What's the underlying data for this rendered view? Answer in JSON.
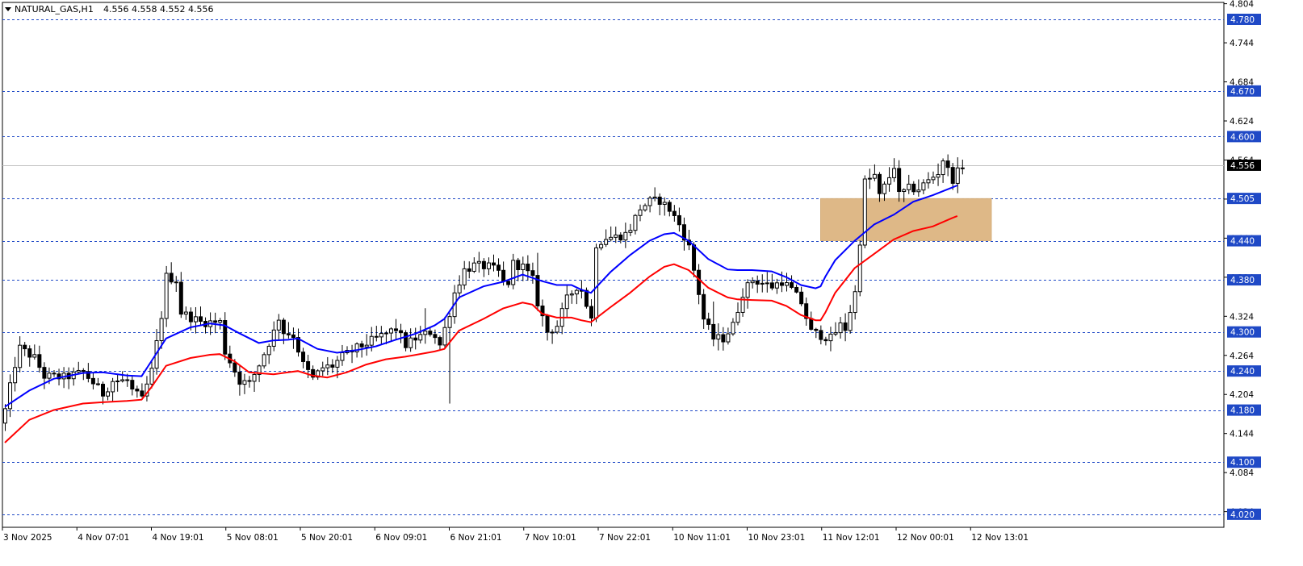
{
  "header": {
    "symbol": "NATURAL_GAS,H1",
    "ohlc": "4.556 4.558 4.552 4.556"
  },
  "colors": {
    "background": "#ffffff",
    "frame": "#000000",
    "level_line": "#1f49c6",
    "level_tag_bg": "#1f49c6",
    "level_tag_text": "#ffffff",
    "price_tag_bg": "#000000",
    "price_tag_text": "#ffffff",
    "bid_line": "#c0c0c0",
    "zone_fill": "#deb887",
    "candle_up_fill": "#ffffff",
    "candle_down_fill": "#000000",
    "ema_fast": "#0000ff",
    "ema_slow": "#ff0000"
  },
  "chart_data": {
    "type": "candlestick",
    "title": "NATURAL_GAS,H1",
    "ylim": [
      4.0,
      4.806
    ],
    "y_ticks": [
      "4.804",
      "4.744",
      "4.684",
      "4.624",
      "4.564",
      "4.504",
      "4.444",
      "4.384",
      "4.324",
      "4.264",
      "4.204",
      "4.144",
      "4.084",
      "4.024"
    ],
    "x_ticks": [
      "3 Nov 2025",
      "4 Nov 07:01",
      "4 Nov 19:01",
      "5 Nov 08:01",
      "5 Nov 20:01",
      "6 Nov 09:01",
      "6 Nov 21:01",
      "7 Nov 10:01",
      "7 Nov 22:01",
      "10 Nov 11:01",
      "10 Nov 23:01",
      "11 Nov 12:01",
      "12 Nov 00:01",
      "12 Nov 13:01"
    ],
    "level_lines": [
      "4.780",
      "4.670",
      "4.600",
      "4.505",
      "4.440",
      "4.380",
      "4.300",
      "4.240",
      "4.180",
      "4.100",
      "4.020"
    ],
    "current_price": "4.556",
    "zone": {
      "price_low": 4.44,
      "price_high": 4.505,
      "from_bar": 167,
      "to_bar": 202
    },
    "ema_fast": [
      [
        0,
        4.185
      ],
      [
        5,
        4.21
      ],
      [
        10,
        4.228
      ],
      [
        16,
        4.237
      ],
      [
        20,
        4.238
      ],
      [
        25,
        4.233
      ],
      [
        28,
        4.232
      ],
      [
        30,
        4.255
      ],
      [
        33,
        4.29
      ],
      [
        38,
        4.307
      ],
      [
        42,
        4.313
      ],
      [
        45,
        4.31
      ],
      [
        48,
        4.298
      ],
      [
        52,
        4.283
      ],
      [
        55,
        4.287
      ],
      [
        58,
        4.288
      ],
      [
        60,
        4.29
      ],
      [
        64,
        4.274
      ],
      [
        68,
        4.268
      ],
      [
        72,
        4.272
      ],
      [
        76,
        4.278
      ],
      [
        80,
        4.288
      ],
      [
        84,
        4.297
      ],
      [
        88,
        4.31
      ],
      [
        90,
        4.32
      ],
      [
        93,
        4.353
      ],
      [
        98,
        4.37
      ],
      [
        102,
        4.377
      ],
      [
        106,
        4.388
      ],
      [
        110,
        4.378
      ],
      [
        113,
        4.372
      ],
      [
        116,
        4.372
      ],
      [
        118,
        4.365
      ],
      [
        120,
        4.36
      ],
      [
        124,
        4.392
      ],
      [
        128,
        4.418
      ],
      [
        132,
        4.44
      ],
      [
        135,
        4.45
      ],
      [
        137,
        4.452
      ],
      [
        140,
        4.44
      ],
      [
        144,
        4.412
      ],
      [
        148,
        4.396
      ],
      [
        150,
        4.395
      ],
      [
        153,
        4.395
      ],
      [
        157,
        4.393
      ],
      [
        160,
        4.384
      ],
      [
        163,
        4.372
      ],
      [
        166,
        4.367
      ],
      [
        167,
        4.37
      ],
      [
        168,
        4.385
      ],
      [
        170,
        4.41
      ],
      [
        174,
        4.44
      ],
      [
        178,
        4.465
      ],
      [
        182,
        4.48
      ],
      [
        186,
        4.5
      ],
      [
        190,
        4.51
      ],
      [
        194,
        4.522
      ],
      [
        195,
        4.525
      ]
    ],
    "ema_slow": [
      [
        0,
        4.13
      ],
      [
        5,
        4.165
      ],
      [
        10,
        4.18
      ],
      [
        16,
        4.19
      ],
      [
        20,
        4.192
      ],
      [
        25,
        4.194
      ],
      [
        28,
        4.196
      ],
      [
        30,
        4.215
      ],
      [
        33,
        4.248
      ],
      [
        38,
        4.26
      ],
      [
        42,
        4.265
      ],
      [
        44,
        4.266
      ],
      [
        47,
        4.255
      ],
      [
        50,
        4.238
      ],
      [
        55,
        4.235
      ],
      [
        58,
        4.238
      ],
      [
        60,
        4.24
      ],
      [
        63,
        4.233
      ],
      [
        66,
        4.23
      ],
      [
        70,
        4.238
      ],
      [
        74,
        4.25
      ],
      [
        78,
        4.258
      ],
      [
        82,
        4.262
      ],
      [
        88,
        4.27
      ],
      [
        90,
        4.274
      ],
      [
        93,
        4.302
      ],
      [
        98,
        4.32
      ],
      [
        102,
        4.336
      ],
      [
        106,
        4.345
      ],
      [
        108,
        4.342
      ],
      [
        110,
        4.328
      ],
      [
        113,
        4.322
      ],
      [
        116,
        4.322
      ],
      [
        118,
        4.318
      ],
      [
        120,
        4.315
      ],
      [
        124,
        4.338
      ],
      [
        128,
        4.36
      ],
      [
        132,
        4.385
      ],
      [
        135,
        4.4
      ],
      [
        137,
        4.404
      ],
      [
        140,
        4.395
      ],
      [
        144,
        4.368
      ],
      [
        148,
        4.353
      ],
      [
        150,
        4.35
      ],
      [
        153,
        4.349
      ],
      [
        157,
        4.348
      ],
      [
        160,
        4.34
      ],
      [
        163,
        4.326
      ],
      [
        166,
        4.318
      ],
      [
        167,
        4.318
      ],
      [
        168,
        4.33
      ],
      [
        170,
        4.36
      ],
      [
        174,
        4.398
      ],
      [
        178,
        4.42
      ],
      [
        182,
        4.442
      ],
      [
        186,
        4.455
      ],
      [
        190,
        4.462
      ],
      [
        194,
        4.475
      ],
      [
        195,
        4.478
      ]
    ],
    "candle_anchors": [
      [
        0,
        4.18
      ],
      [
        2,
        4.25
      ],
      [
        3,
        4.275
      ],
      [
        6,
        4.26
      ],
      [
        8,
        4.232
      ],
      [
        12,
        4.23
      ],
      [
        16,
        4.238
      ],
      [
        18,
        4.222
      ],
      [
        20,
        4.205
      ],
      [
        22,
        4.225
      ],
      [
        25,
        4.225
      ],
      [
        26,
        4.21
      ],
      [
        28,
        4.196
      ],
      [
        30,
        4.24
      ],
      [
        32,
        4.325
      ],
      [
        33,
        4.385
      ],
      [
        35,
        4.38
      ],
      [
        36,
        4.33
      ],
      [
        40,
        4.315
      ],
      [
        44,
        4.315
      ],
      [
        45,
        4.27
      ],
      [
        48,
        4.225
      ],
      [
        50,
        4.22
      ],
      [
        52,
        4.25
      ],
      [
        55,
        4.3
      ],
      [
        56,
        4.322
      ],
      [
        57,
        4.3
      ],
      [
        59,
        4.295
      ],
      [
        61,
        4.25
      ],
      [
        63,
        4.228
      ],
      [
        65,
        4.245
      ],
      [
        67,
        4.248
      ],
      [
        69,
        4.262
      ],
      [
        72,
        4.275
      ],
      [
        76,
        4.29
      ],
      [
        80,
        4.305
      ],
      [
        82,
        4.28
      ],
      [
        84,
        4.29
      ],
      [
        87,
        4.3
      ],
      [
        88,
        4.295
      ],
      [
        89,
        4.28
      ],
      [
        91,
        4.33
      ],
      [
        92,
        4.36
      ],
      [
        94,
        4.395
      ],
      [
        96,
        4.402
      ],
      [
        99,
        4.4
      ],
      [
        101,
        4.392
      ],
      [
        102,
        4.375
      ],
      [
        103,
        4.376
      ],
      [
        104,
        4.405
      ],
      [
        106,
        4.4
      ],
      [
        108,
        4.38
      ],
      [
        109,
        4.345
      ],
      [
        111,
        4.3
      ],
      [
        113,
        4.31
      ],
      [
        115,
        4.35
      ],
      [
        117,
        4.37
      ],
      [
        118,
        4.365
      ],
      [
        120,
        4.32
      ],
      [
        121,
        4.435
      ],
      [
        123,
        4.445
      ],
      [
        125,
        4.446
      ],
      [
        127,
        4.45
      ],
      [
        128,
        4.46
      ],
      [
        130,
        4.49
      ],
      [
        132,
        4.5
      ],
      [
        134,
        4.502
      ],
      [
        136,
        4.488
      ],
      [
        138,
        4.465
      ],
      [
        140,
        4.43
      ],
      [
        142,
        4.36
      ],
      [
        143,
        4.32
      ],
      [
        145,
        4.29
      ],
      [
        147,
        4.29
      ],
      [
        149,
        4.31
      ],
      [
        151,
        4.36
      ],
      [
        153,
        4.38
      ],
      [
        155,
        4.375
      ],
      [
        157,
        4.37
      ],
      [
        159,
        4.378
      ],
      [
        161,
        4.365
      ],
      [
        163,
        4.345
      ],
      [
        165,
        4.3
      ],
      [
        167,
        4.295
      ],
      [
        169,
        4.29
      ],
      [
        171,
        4.31
      ],
      [
        172,
        4.305
      ],
      [
        174,
        4.36
      ],
      [
        175,
        4.44
      ],
      [
        176,
        4.53
      ],
      [
        178,
        4.54
      ],
      [
        179,
        4.508
      ],
      [
        181,
        4.538
      ],
      [
        182,
        4.555
      ],
      [
        183,
        4.51
      ],
      [
        185,
        4.52
      ],
      [
        187,
        4.52
      ],
      [
        189,
        4.532
      ],
      [
        191,
        4.545
      ],
      [
        192,
        4.565
      ],
      [
        193,
        4.548
      ],
      [
        194,
        4.535
      ],
      [
        195,
        4.545
      ],
      [
        196,
        4.556
      ]
    ]
  }
}
